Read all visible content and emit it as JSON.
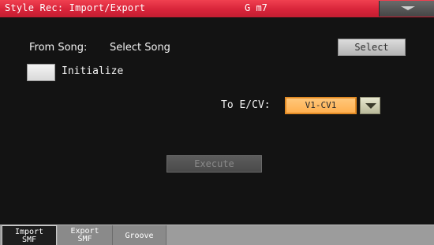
{
  "header": {
    "title": "Style Rec: Import/Export",
    "chord": "G m7",
    "menu_icon": "triangle-down-icon"
  },
  "main": {
    "from_song_label": "From Song:",
    "from_song_value": "Select Song",
    "select_button": "Select",
    "initialize_label": "Initialize",
    "initialize_checked": false,
    "to_ecv_label": "To E/CV:",
    "to_ecv_value": "V1-CV1",
    "execute_button": "Execute"
  },
  "tabs": [
    {
      "line1": "Import",
      "line2": "SMF",
      "active": true
    },
    {
      "line1": "Export",
      "line2": "SMF",
      "active": false
    },
    {
      "line1": "Groove",
      "line2": "",
      "active": false
    }
  ],
  "colors": {
    "title_bar": "#d8243a",
    "selected_value": "#ffb050",
    "background": "#131313"
  }
}
